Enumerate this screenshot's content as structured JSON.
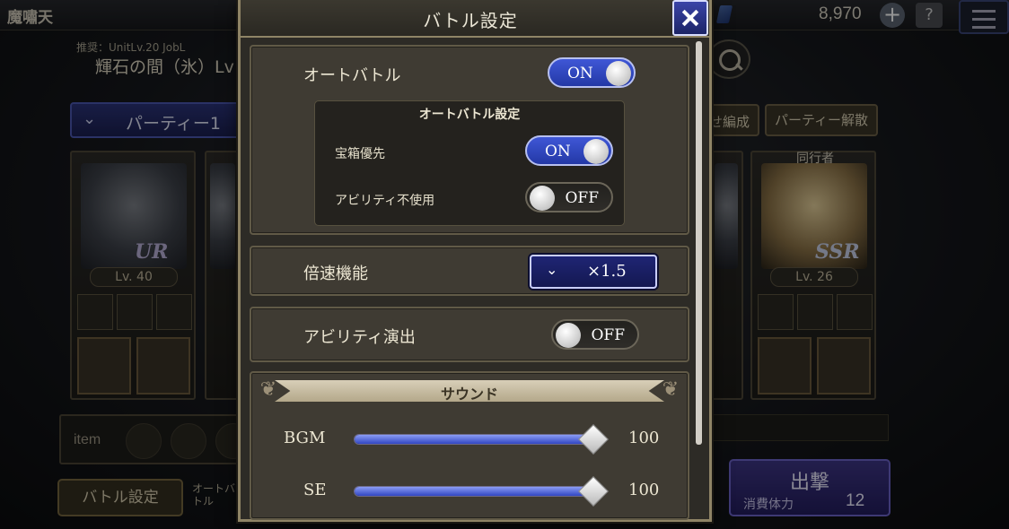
{
  "background": {
    "top_title": "魔嘯天",
    "gil_amount": "8,970",
    "recommend": "推奨：UnitLv.20 JobL",
    "stage": "輝石の間（氷）Lv",
    "party_label": "パーティー1",
    "hensei_label": "せ編成",
    "disband_label": "パーティー解散",
    "companion_label": "同行者",
    "units": [
      {
        "rarity": "UR",
        "level": "Lv. 40"
      },
      {
        "rarity": "SSR",
        "level": "Lv. 26"
      }
    ],
    "item_label": "item",
    "battle_settings_label": "バトル設定",
    "auto_battle_short": "オートバトル",
    "sortie_label": "出撃",
    "stamina_label": "消費体力",
    "stamina_value": "12"
  },
  "modal": {
    "title": "バトル設定",
    "auto_battle": {
      "label": "オートバトル",
      "state": "ON"
    },
    "auto_settings": {
      "title": "オートバトル設定",
      "treasure": {
        "label": "宝箱優先",
        "state": "ON"
      },
      "no_ability": {
        "label": "アビリティ不使用",
        "state": "OFF"
      }
    },
    "speed": {
      "label": "倍速機能",
      "value": "×1.5"
    },
    "ability_effect": {
      "label": "アビリティ演出",
      "state": "OFF"
    },
    "sound": {
      "title": "サウンド",
      "bgm": {
        "label": "BGM",
        "value": "100",
        "level": 100
      },
      "se": {
        "label": "SE",
        "value": "100",
        "level": 100
      }
    }
  },
  "colors": {
    "toggle_on": "#3f57d6",
    "frame_gold": "#8f8466",
    "panel": "#3f3b33",
    "close_blue": "#2a339a"
  }
}
